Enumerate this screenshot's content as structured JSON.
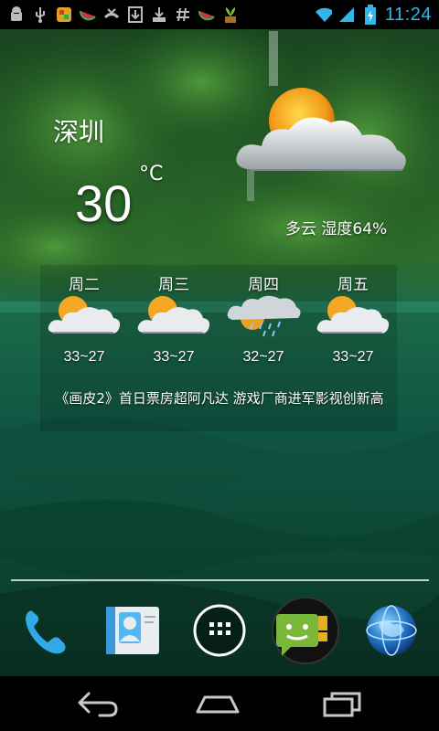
{
  "status_bar": {
    "time": "11:24",
    "left_icons": [
      "android-debug-icon",
      "usb-icon",
      "color-app-icon",
      "watermelon-icon",
      "missed-call-icon",
      "download-icon",
      "download-box-icon",
      "hash-icon",
      "watermelon-icon",
      "plant-icon"
    ],
    "right_icons": [
      "wifi-icon",
      "signal-icon",
      "battery-charging-icon"
    ]
  },
  "weather": {
    "city": "深圳",
    "temperature": "30",
    "unit": "°C",
    "condition": "多云 湿度64%",
    "current_icon": "partly-cloudy-icon",
    "forecast": [
      {
        "day": "周二",
        "range": "33~27",
        "icon": "partly-cloudy-icon"
      },
      {
        "day": "周三",
        "range": "33~27",
        "icon": "partly-cloudy-icon"
      },
      {
        "day": "周四",
        "range": "32~27",
        "icon": "rain-shower-icon"
      },
      {
        "day": "周五",
        "range": "33~27",
        "icon": "partly-cloudy-icon"
      }
    ],
    "news": "《画皮2》首日票房超阿凡达 游戏厂商进军影视创新高"
  },
  "dock": {
    "items": [
      "phone-icon",
      "contacts-icon",
      "all-apps-icon",
      "messaging-icon",
      "browser-globe-icon"
    ]
  },
  "nav_bar": {
    "buttons": [
      "back-icon",
      "home-icon",
      "recent-apps-icon"
    ]
  },
  "colors": {
    "clock": "#33b5e5",
    "wallpaper_green": "#1f6b35",
    "water": "#0f5a46"
  }
}
